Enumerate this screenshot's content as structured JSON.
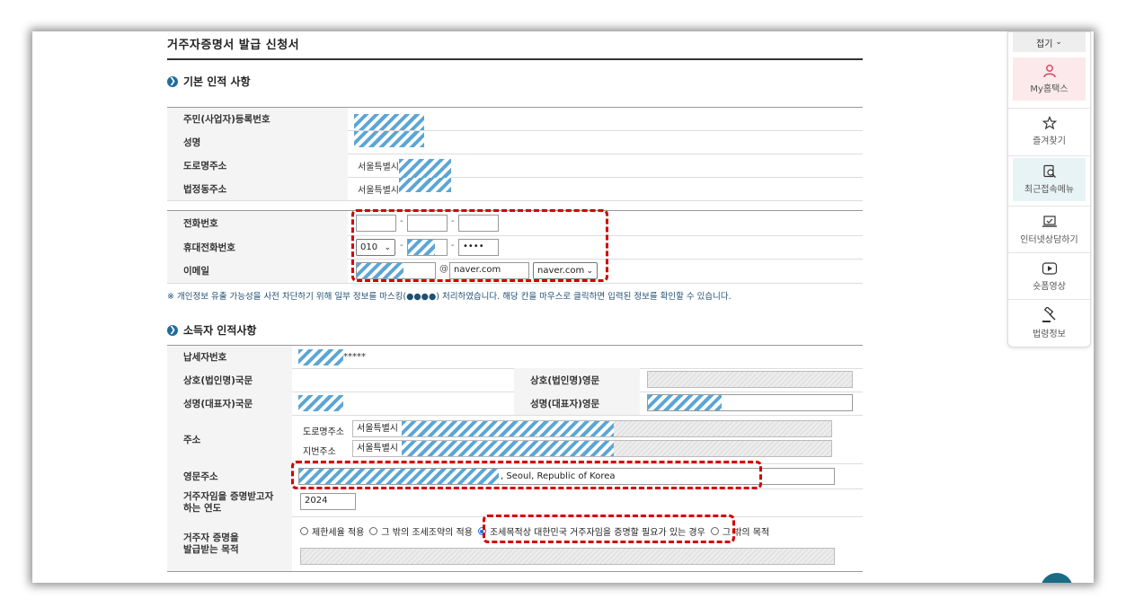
{
  "page_title": "거주자증명서 발급 신청서",
  "section1": {
    "title": "기본 인적 사항",
    "labels": [
      "주민(사업자)등록번호",
      "성명",
      "도로명주소",
      "법정동주소"
    ],
    "road_address_prefix": "서울특별시",
    "legal_address_prefix": "서울특별시",
    "contact": {
      "phone_label": "전화번호",
      "mobile_label": "휴대전화번호",
      "mobile_prefix": "010",
      "mobile_last": "••••",
      "email_label": "이메일",
      "email_at": "@",
      "email_domain": "naver.com",
      "email_domain_select": "naver.com"
    }
  },
  "notice": "※ 개인정보 유출 가능성을 사전 차단하기 위해 일부 정보를 마스킹(●●●●) 처리하였습니다. 해당 칸을 마우스로 클릭하면 입력된 정보를 확인할 수 있습니다.",
  "section2": {
    "title": "소득자 인적사항",
    "tax_id_label": "납세자번호",
    "tax_id_suffix": "*****",
    "company_kr_label": "상호(법인명)국문",
    "company_en_label": "상호(법인명)영문",
    "name_kr_label": "성명(대표자)국문",
    "name_en_label": "성명(대표자)영문",
    "address_label": "주소",
    "road_sub_label": "도로명주소",
    "lot_sub_label": "지번주소",
    "road_value_prefix": "서울특별시",
    "lot_value_prefix": "서울특별시",
    "eng_address_label": "영문주소",
    "eng_address_suffix": ", Seoul, Republic of Korea",
    "year_label_1": "거주자임을 증명받고자",
    "year_label_2": "하는 연도",
    "year_value": "2024",
    "purpose_label_1": "거주자 증명을",
    "purpose_label_2": "발급받는 목적",
    "purpose_options": [
      {
        "label": "제한세율 적용",
        "selected": false
      },
      {
        "label": "그 밖의 조세조약의 적용",
        "selected": false
      },
      {
        "label": "조세목적상 대한민국 거주자임을 증명할 필요가 있는 경우",
        "selected": true
      },
      {
        "label": "그 밖의 목적",
        "selected": false
      }
    ]
  },
  "sidebar": {
    "fold": "접기",
    "items": [
      {
        "label": "My홈택스",
        "icon": "person-icon"
      },
      {
        "label": "즐겨찾기",
        "icon": "star-icon"
      },
      {
        "label": "최근접속메뉴",
        "icon": "search-doc-icon"
      },
      {
        "label": "인터넷상담하기",
        "icon": "laptop-check-icon"
      },
      {
        "label": "숏폼영상",
        "icon": "play-icon"
      },
      {
        "label": "법령정보",
        "icon": "gavel-icon"
      }
    ]
  },
  "colors": {
    "accent": "#1f6d9c",
    "highlight_box": "#d40000",
    "mask": "#5ba6d6",
    "sidebar_active": "#fbe9ec",
    "sidebar_recent": "#e8f3f6"
  }
}
